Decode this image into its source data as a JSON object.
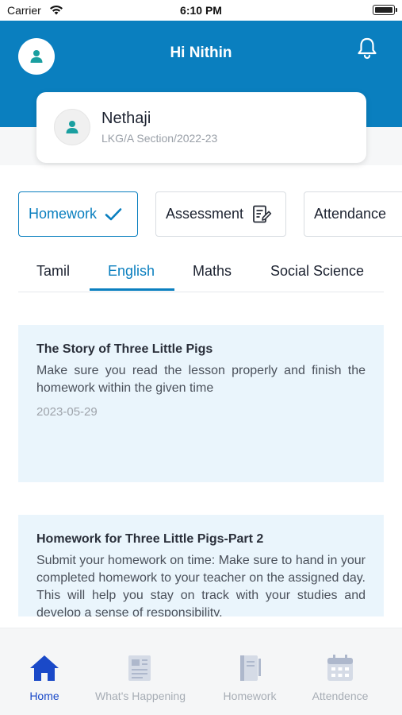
{
  "status_bar": {
    "carrier": "Carrier",
    "time": "6:10 PM"
  },
  "header": {
    "greeting": "Hi Nithin"
  },
  "student": {
    "name": "Nethaji",
    "class_info": "LKG/A Section/2022-23"
  },
  "categories": [
    {
      "label": "Homework",
      "icon": "check-icon",
      "active": true
    },
    {
      "label": "Assessment",
      "icon": "assessment-icon",
      "active": false
    },
    {
      "label": "Attendance",
      "icon": "",
      "active": false
    }
  ],
  "subjects": [
    {
      "label": "Tamil",
      "active": false
    },
    {
      "label": "English",
      "active": true
    },
    {
      "label": "Maths",
      "active": false
    },
    {
      "label": "Social Science",
      "active": false
    }
  ],
  "homework": [
    {
      "title": "The Story of Three Little Pigs",
      "description": "Make sure you read the lesson properly and finish the homework within the given time",
      "date": "2023-05-29"
    },
    {
      "title": "Homework for Three Little Pigs-Part 2",
      "description": "Submit your homework on time: Make sure to hand in your completed homework to your teacher on the assigned day. This will help you stay on track with your studies and develop a sense of responsibility."
    }
  ],
  "bottom_nav": [
    {
      "label": "Home",
      "icon": "home-icon",
      "active": true
    },
    {
      "label": "What's Happening",
      "icon": "newspaper-icon",
      "active": false
    },
    {
      "label": "Homework",
      "icon": "notebook-icon",
      "active": false
    },
    {
      "label": "Attendence",
      "icon": "calendar-icon",
      "active": false
    }
  ],
  "colors": {
    "primary": "#0a7fbf",
    "nav_active": "#1a49c8",
    "card_bg": "#eaf5fc"
  }
}
